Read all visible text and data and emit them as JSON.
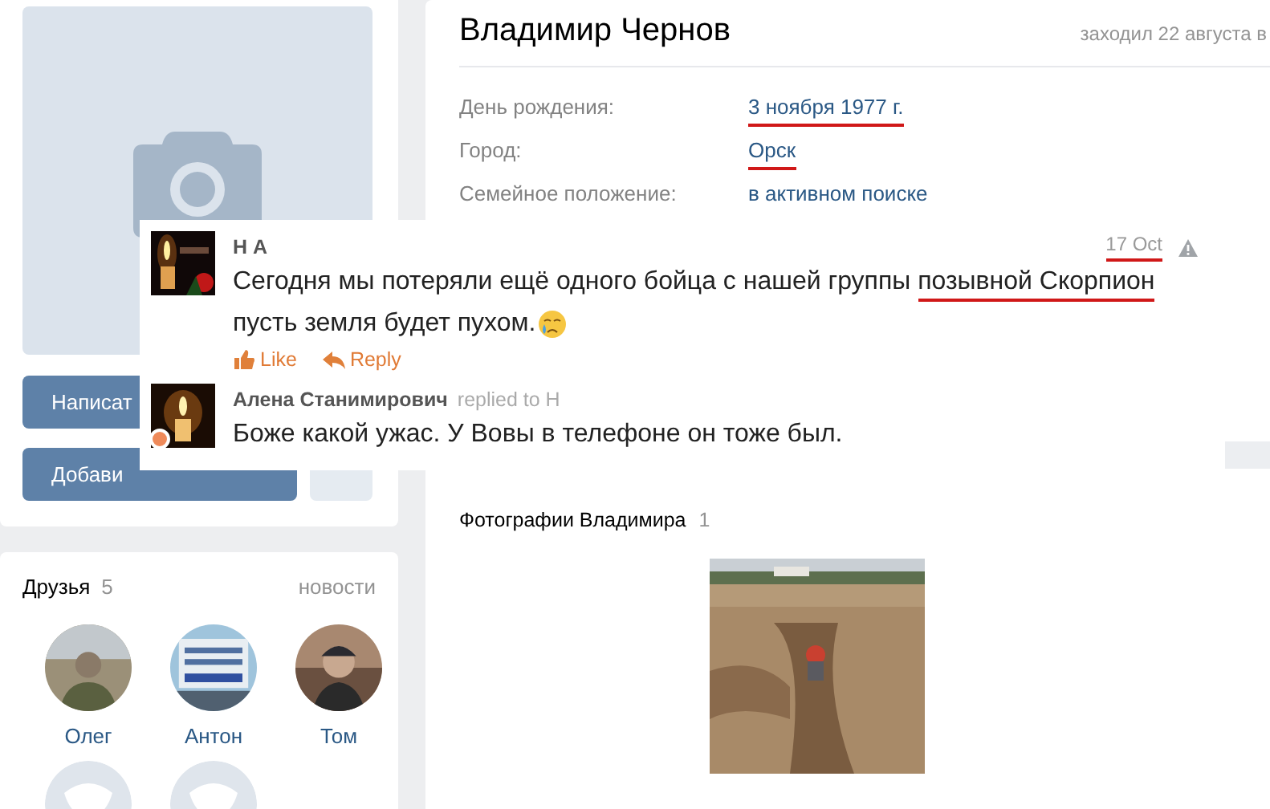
{
  "sidebar": {
    "buttons": [
      {
        "kind": "primary",
        "label": "Написат"
      },
      {
        "kind": "primary",
        "label": "Добави"
      },
      {
        "kind": "more"
      }
    ],
    "friends": {
      "title": "Друзья",
      "count": "5",
      "link": "новости",
      "items": [
        {
          "name": "Олег"
        },
        {
          "name": "Антон"
        },
        {
          "name": "Том"
        },
        {
          "kind": "placeholder"
        },
        {
          "kind": "placeholder"
        }
      ]
    }
  },
  "profile": {
    "name": "Владимир Чернов",
    "last_seen": "заходил 22 августа в",
    "info": [
      {
        "label": "День рождения:",
        "value": "3 ноября 1977 г.",
        "highlighted": true
      },
      {
        "label": "Город:",
        "value": "Орск",
        "highlighted": true
      },
      {
        "label": "Семейное положение:",
        "value": "в активном поиске",
        "highlighted": false
      }
    ],
    "photos": {
      "title": "Фотографии Владимира",
      "count": "1"
    }
  },
  "comments": [
    {
      "author": "Н А",
      "date": "17 Oct",
      "date_highlighted": true,
      "lines": [
        [
          {
            "text": "Сегодня мы потеряли ещё одного бойца с нашей группы ",
            "highlighted": false
          },
          {
            "text": "позывной Скорпион",
            "highlighted": true
          }
        ],
        [
          {
            "text": "пусть земля будет пухом.",
            "highlighted": false
          }
        ]
      ],
      "emoji": true,
      "actions": [
        {
          "kind": "like",
          "label": "Like"
        },
        {
          "kind": "reply",
          "label": "Reply"
        }
      ]
    },
    {
      "author": "Алена Станимирович",
      "reply_to": "replied to Н",
      "lines": [
        [
          {
            "text": "Боже какой ужас. У Вовы в телефоне он тоже был.",
            "highlighted": false
          }
        ]
      ],
      "online": true
    }
  ]
}
